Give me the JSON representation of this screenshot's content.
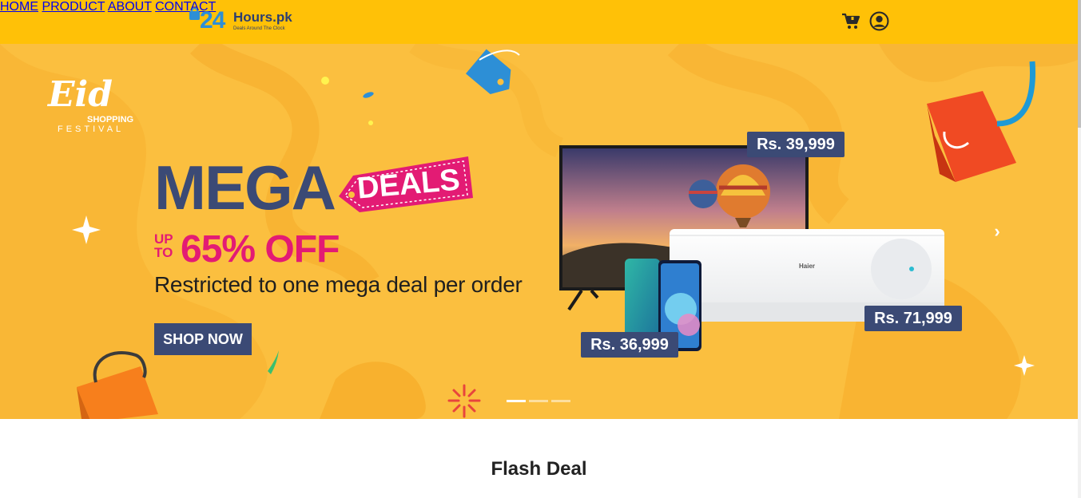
{
  "header": {
    "logo": {
      "mark": "24",
      "word": "Hours.pk",
      "tagline": "Deals Around The Clock"
    },
    "nav": [
      {
        "label": "HOME"
      },
      {
        "label": "PRODUCT"
      },
      {
        "label": "ABOUT"
      },
      {
        "label": "CONTACT"
      }
    ],
    "icons": {
      "cart": "cart-icon",
      "account": "user-circle-icon"
    },
    "colors": {
      "bar": "#ffc107",
      "text": "#2a2a2a"
    }
  },
  "hero": {
    "eid_script": "Eid",
    "eid_shopping": "SHOPPING",
    "eid_festival": "FESTIVAL",
    "headline": "MEGA",
    "deals_tag": "DEALS",
    "up": "UP",
    "to": "TO",
    "discount": "65% OFF",
    "restriction": "Restricted to one mega deal per order",
    "cta": "SHOP NOW",
    "tv_brand": "Haier",
    "prices": [
      "Rs. 39,999",
      "Rs. 71,999",
      "Rs. 36,999"
    ],
    "slides": {
      "count": 3,
      "active": 1
    },
    "colors": {
      "background": "#fbbf3f",
      "navy": "#3b4a75",
      "pink": "#e31b74"
    }
  },
  "flash": {
    "title": "Flash Deal"
  }
}
